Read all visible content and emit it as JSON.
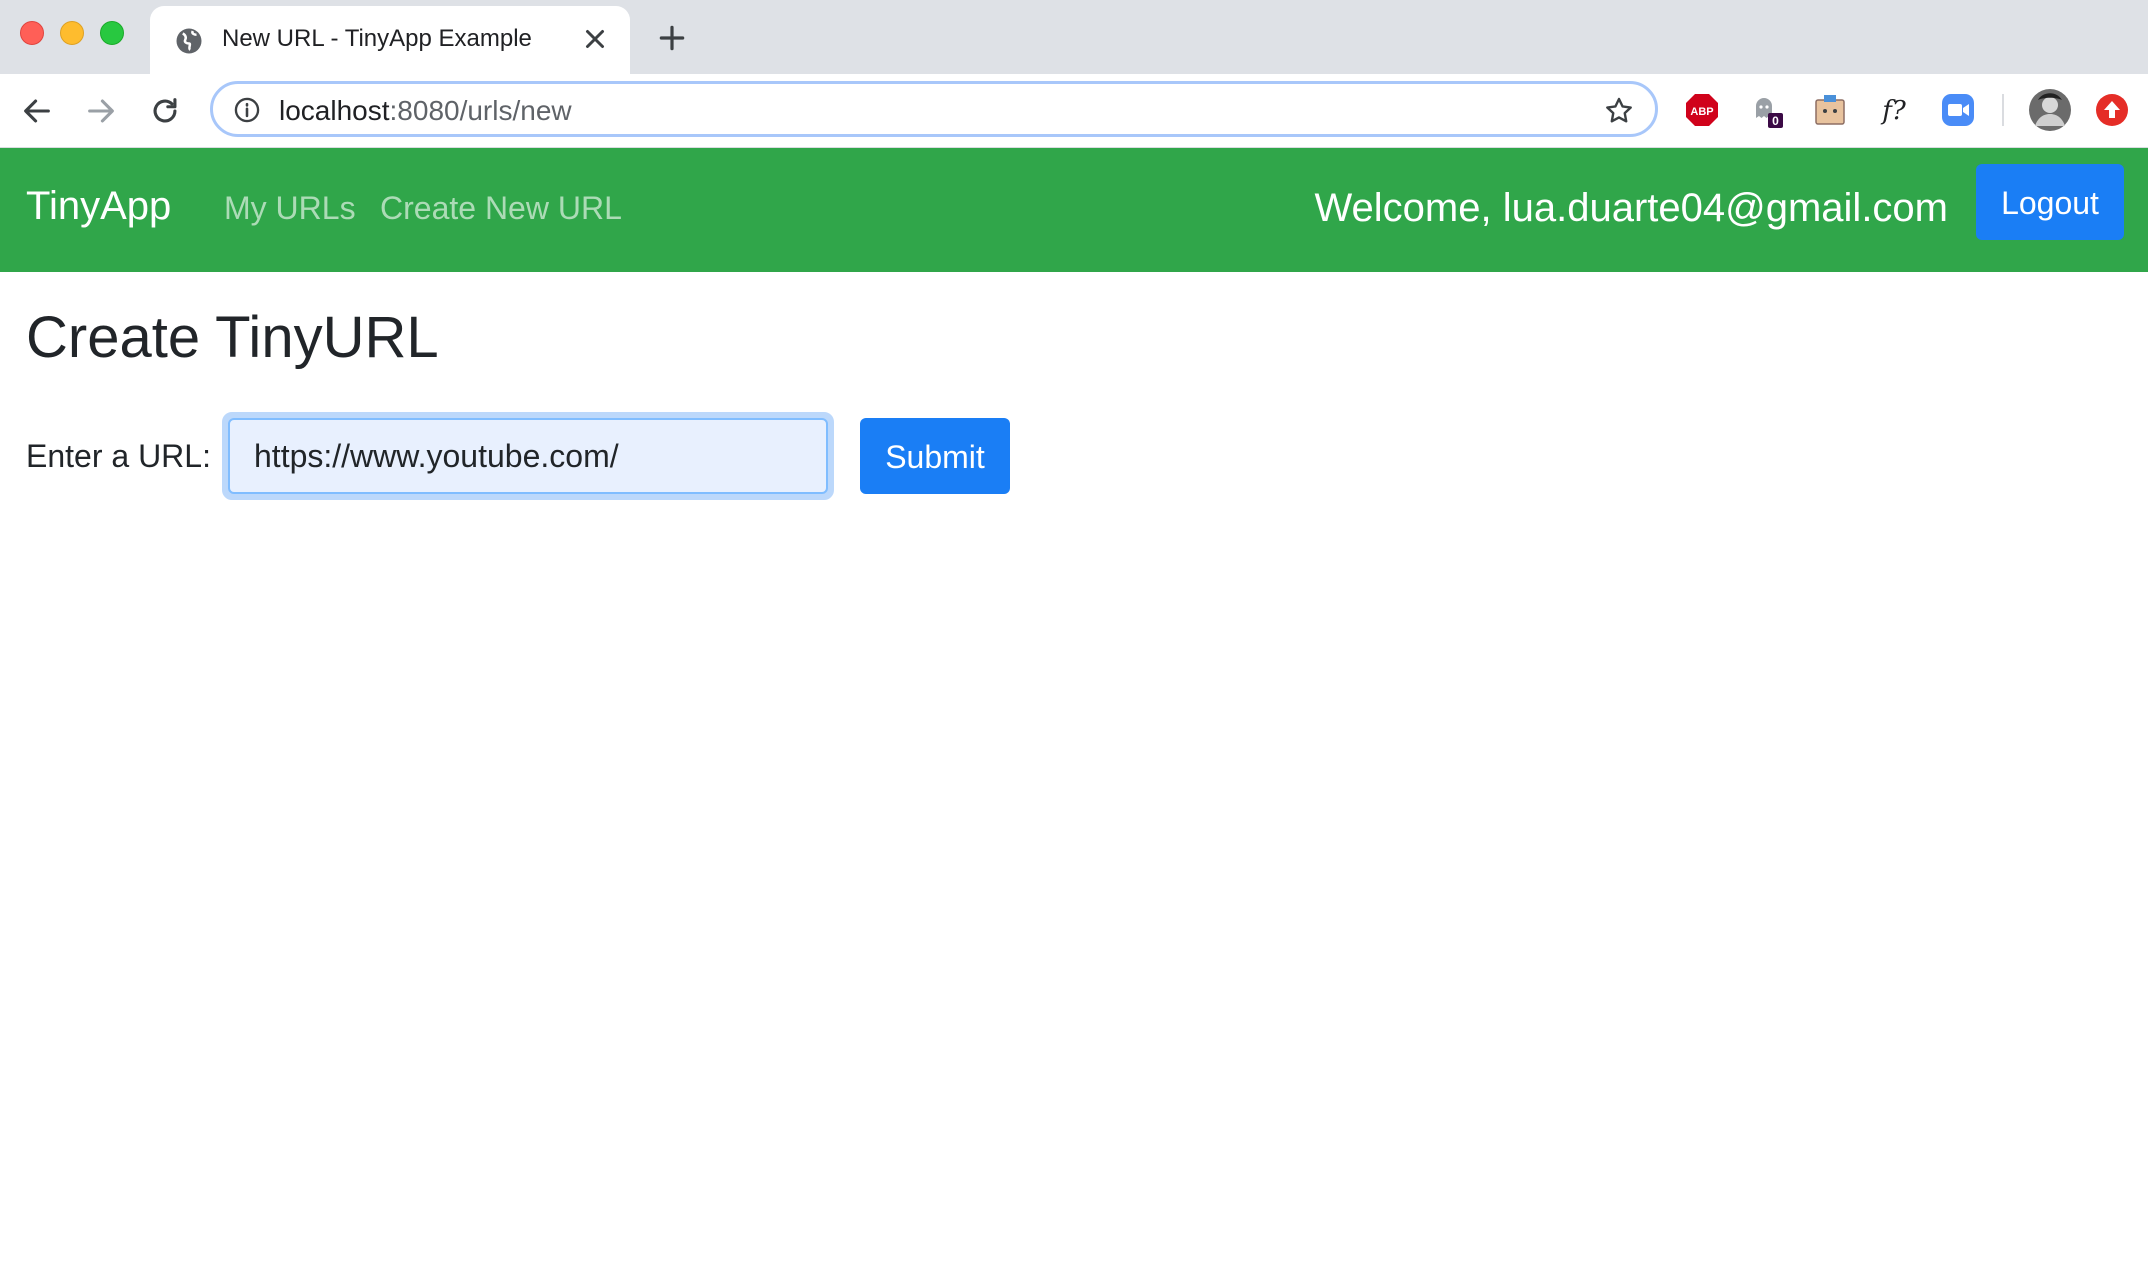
{
  "browser": {
    "tab_title": "New URL - TinyApp Example",
    "url_host": "localhost",
    "url_rest": ":8080/urls/new",
    "extensions": [
      {
        "name": "adblock-plus-icon",
        "label": "ABP"
      },
      {
        "name": "ghostery-icon",
        "badge": "0"
      },
      {
        "name": "extension-box-icon"
      },
      {
        "name": "whatfont-icon",
        "label": "f?"
      },
      {
        "name": "zoom-icon"
      },
      {
        "name": "profile-avatar-icon"
      },
      {
        "name": "update-arrow-icon"
      }
    ]
  },
  "navbar": {
    "brand": "TinyApp",
    "links": [
      "My URLs",
      "Create New URL"
    ],
    "welcome": "Welcome, lua.duarte04@gmail.com",
    "logout_label": "Logout",
    "color": "#30a64a"
  },
  "main": {
    "title": "Create TinyURL",
    "form": {
      "label": "Enter a URL:",
      "input_value": "https://www.youtube.com/",
      "submit_label": "Submit"
    }
  },
  "colors": {
    "primary_button": "#1a7ef5",
    "navbar": "#30a64a"
  }
}
